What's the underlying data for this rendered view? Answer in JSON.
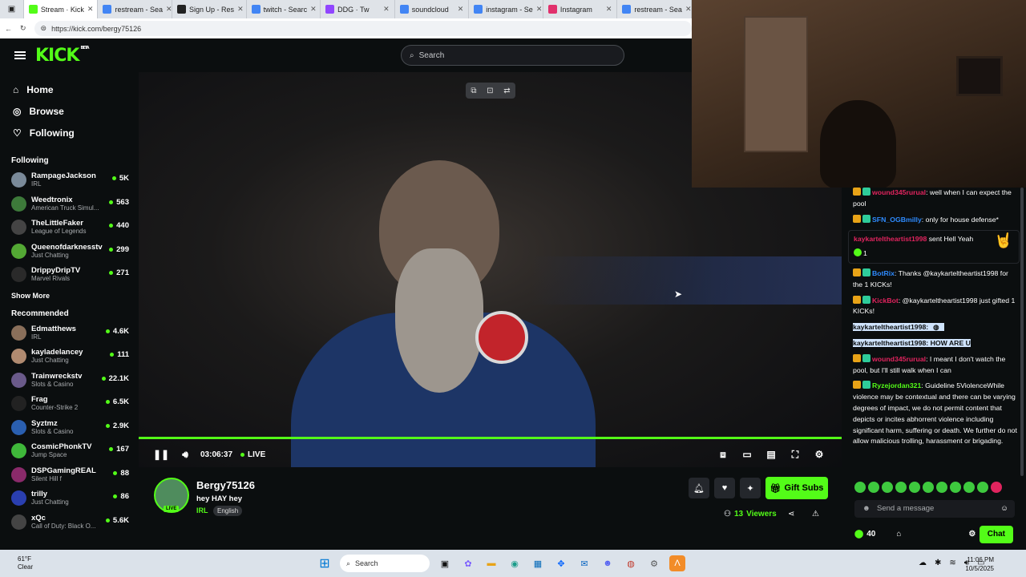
{
  "browser": {
    "tabs": [
      {
        "title": "Stream · Kick",
        "color": "#53fc18",
        "icon": "kick-icon"
      },
      {
        "title": "restream - Sea",
        "color": "#4285f4",
        "icon": "search-icon"
      },
      {
        "title": "Sign Up - Res",
        "color": "#222222",
        "icon": "restream-icon"
      },
      {
        "title": "twitch - Searc",
        "color": "#4285f4",
        "icon": "search-icon"
      },
      {
        "title": "DDG · Tw",
        "color": "#9146ff",
        "icon": "twitch-icon"
      },
      {
        "title": "soundcloud",
        "color": "#4285f4",
        "icon": "search-icon"
      },
      {
        "title": "instagram - Se",
        "color": "#4285f4",
        "icon": "search-icon"
      },
      {
        "title": "Instagram",
        "color": "#e1306c",
        "icon": "instagram-icon"
      },
      {
        "title": "restream - Sea",
        "color": "#4285f4",
        "icon": "search-icon"
      }
    ],
    "url": "https://kick.com/bergy75126"
  },
  "header": {
    "logo": "KICK",
    "beta": "BETA",
    "search_placeholder": "Search"
  },
  "nav": [
    {
      "label": "Home",
      "icon": "home-icon"
    },
    {
      "label": "Browse",
      "icon": "compass-icon"
    },
    {
      "label": "Following",
      "icon": "heart-icon"
    }
  ],
  "following_title": "Following",
  "following": [
    {
      "name": "RampageJackson",
      "category": "IRL",
      "viewers": "5K",
      "color": "#7a8a99"
    },
    {
      "name": "Weedtronix",
      "category": "American Truck Simul...",
      "viewers": "563",
      "color": "#3d7a3a"
    },
    {
      "name": "TheLittleFaker",
      "category": "League of Legends",
      "viewers": "440",
      "color": "#444444"
    },
    {
      "name": "Queenofdarknesstv",
      "category": "Just Chatting",
      "viewers": "299",
      "color": "#53a834"
    },
    {
      "name": "DrippyDripTV",
      "category": "Marvel Rivals",
      "viewers": "271",
      "color": "#2a2a2a"
    }
  ],
  "show_more": "Show More",
  "recommended_title": "Recommended",
  "recommended": [
    {
      "name": "Edmatthews",
      "category": "IRL",
      "viewers": "4.6K",
      "color": "#8a6f5a"
    },
    {
      "name": "kayladelancey",
      "category": "Just Chatting",
      "viewers": "111",
      "color": "#b08a70"
    },
    {
      "name": "Trainwreckstv",
      "category": "Slots & Casino",
      "viewers": "22.1K",
      "color": "#6a5a8a"
    },
    {
      "name": "Frag",
      "category": "Counter-Strike 2",
      "viewers": "6.5K",
      "color": "#222222"
    },
    {
      "name": "Syztmz",
      "category": "Slots & Casino",
      "viewers": "2.9K",
      "color": "#2a5fb0"
    },
    {
      "name": "CosmicPhonkTV",
      "category": "Jump Space",
      "viewers": "167",
      "color": "#3fb83a"
    },
    {
      "name": "DSPGamingREAL",
      "category": "Silent Hill f",
      "viewers": "88",
      "color": "#8a2a6a"
    },
    {
      "name": "trilly",
      "category": "Just Chatting",
      "viewers": "86",
      "color": "#2a3fb0"
    },
    {
      "name": "xQc",
      "category": "Call of Duty: Black O...",
      "viewers": "5.6K",
      "color": "#444444"
    }
  ],
  "player": {
    "time": "03:06:37",
    "live": "LIVE",
    "progress": 1.0
  },
  "stream": {
    "name": "Bergy75126",
    "title": "hey HAY hey",
    "category": "IRL",
    "language": "English",
    "live_badge": "LIVE",
    "viewers_count": "13",
    "viewers_label": "Viewers",
    "gift_label": "Gift Subs"
  },
  "chat": {
    "messages": [
      {
        "user": "wound345rurual",
        "user_color": "#e0245e",
        "text": ": well when I can expect the pool"
      },
      {
        "user": "SFN_OGBmilly",
        "user_color": "#2e8bff",
        "text": ": only for house defense*"
      },
      {
        "gift_user": "kaykarteltheartist1998",
        "gift_text": " sent Hell Yeah",
        "gift_count": "1"
      },
      {
        "user": "BotRix",
        "user_color": "#2e8bff",
        "text": ": Thanks @kaykarteltheartist1998 for the 1 KICKs!"
      },
      {
        "user": "KickBot",
        "user_color": "#e0245e",
        "text": ": @kaykarteltheartist1998 just gifted 1 KICKs!"
      },
      {
        "highlight1": "kaykarteltheartist1998:"
      },
      {
        "highlight2": "kaykarteltheartist1998: HOW ARE U"
      },
      {
        "user": "wound345rurual",
        "user_color": "#e0245e",
        "text": ": I meant I don't watch the pool, but I'll still walk when I can"
      },
      {
        "user": "Ryzejordan321",
        "user_color": "#53fc18",
        "text": ": Guideline 5ViolenceWhile violence may be contextual and there can be varying degrees of impact, we do not permit content that depicts or incites abhorrent violence including significant harm, suffering or death. We further do not allow malicious trolling, harassment or brigading."
      }
    ],
    "send_placeholder": "Send a message",
    "points": "40",
    "chat_button": "Chat"
  },
  "taskbar": {
    "temp": "61°F",
    "weather": "Clear",
    "search": "Search",
    "time": "11:06 PM",
    "date": "10/5/2025"
  }
}
